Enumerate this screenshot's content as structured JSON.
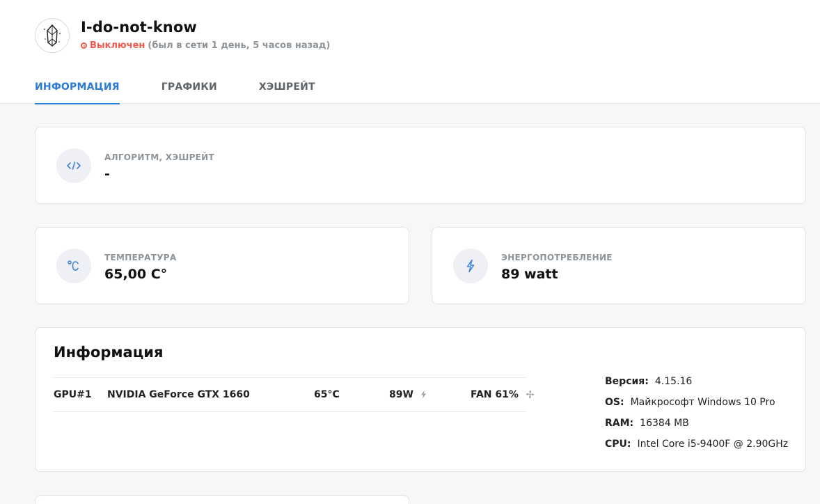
{
  "worker": {
    "name": "I-do-not-know",
    "status": "Выключен",
    "last_seen": "(был в сети 1 день, 5 часов назад)"
  },
  "tabs": [
    {
      "label": "ИНФОРМАЦИЯ",
      "active": true
    },
    {
      "label": "ГРАФИКИ",
      "active": false
    },
    {
      "label": "ХЭШРЕЙТ",
      "active": false
    }
  ],
  "cards": {
    "algorithm": {
      "label": "АЛГОРИТМ, ХЭШРЕЙТ",
      "value": "-",
      "icon": "code-icon"
    },
    "temperature": {
      "label": "ТЕМПЕРАТУРА",
      "value": "65,00 C°",
      "icon": "celsius-icon"
    },
    "power": {
      "label": "ЭНЕРГОПОТРЕБЛЕНИЕ",
      "value": "89 watt",
      "icon": "lightning-icon"
    }
  },
  "info": {
    "title": "Информация",
    "gpus": [
      {
        "id": "GPU#1",
        "model": "NVIDIA GeForce GTX 1660",
        "temp": "65°C",
        "power": "89W",
        "fan": "FAN 61%"
      }
    ],
    "system": [
      {
        "key": "Версия:",
        "value": "4.15.16"
      },
      {
        "key": "OS:",
        "value": "Майкрософт Windows 10 Pro"
      },
      {
        "key": "RAM:",
        "value": "16384 MB"
      },
      {
        "key": "CPU:",
        "value": "Intel Core i5-9400F @ 2.90GHz"
      }
    ]
  },
  "colors": {
    "accent": "#2a7ad6",
    "offline": "#f05b4e",
    "muted": "#8d9499",
    "background": "#f7f7f7"
  }
}
